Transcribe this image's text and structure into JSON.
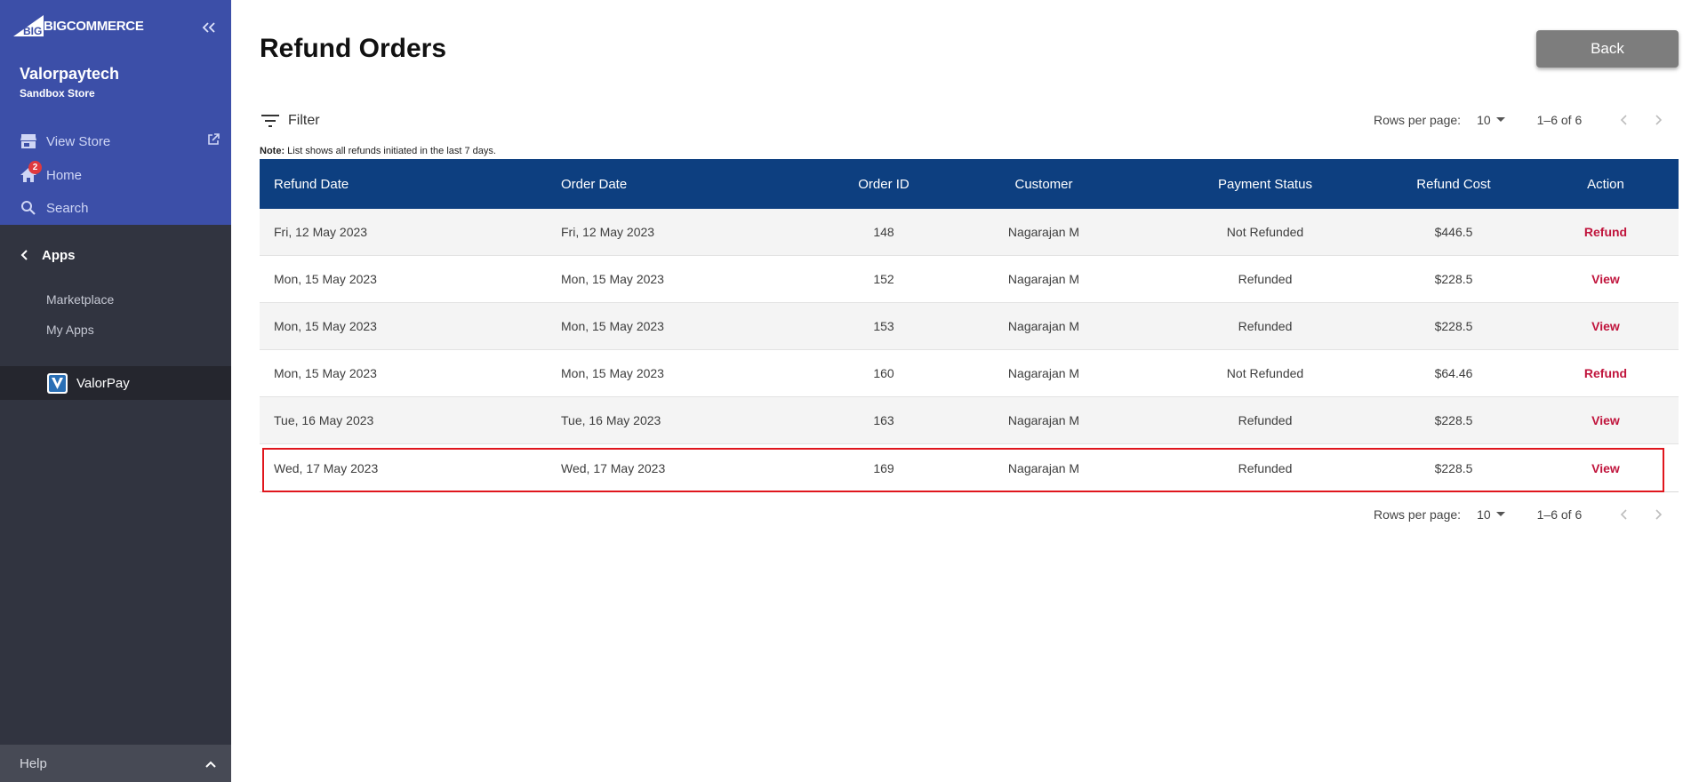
{
  "sidebar": {
    "logo_text": "BIGCOMMERCE",
    "store_name": "Valorpaytech",
    "store_sub": "Sandbox Store",
    "view_store": "View Store",
    "home": "Home",
    "home_badge": "2",
    "search": "Search",
    "apps": "Apps",
    "marketplace": "Marketplace",
    "my_apps": "My Apps",
    "valorpay": "ValorPay",
    "help": "Help"
  },
  "main": {
    "title": "Refund Orders",
    "back_label": "Back",
    "filter_label": "Filter",
    "note_bold": "Note:",
    "note_text": " List shows all refunds initiated in the last 7 days.",
    "pagination": {
      "rows_per_page_label": "Rows per page:",
      "rows_per_page_value": "10",
      "range": "1–6 of 6"
    },
    "columns": [
      "Refund Date",
      "Order Date",
      "Order ID",
      "Customer",
      "Payment Status",
      "Refund Cost",
      "Action"
    ],
    "rows": [
      {
        "refund_date": "Fri, 12 May 2023",
        "order_date": "Fri, 12 May 2023",
        "order_id": "148",
        "customer": "Nagarajan M",
        "status": "Not Refunded",
        "cost": "$446.5",
        "action": "Refund"
      },
      {
        "refund_date": "Mon, 15 May 2023",
        "order_date": "Mon, 15 May 2023",
        "order_id": "152",
        "customer": "Nagarajan M",
        "status": "Refunded",
        "cost": "$228.5",
        "action": "View"
      },
      {
        "refund_date": "Mon, 15 May 2023",
        "order_date": "Mon, 15 May 2023",
        "order_id": "153",
        "customer": "Nagarajan M",
        "status": "Refunded",
        "cost": "$228.5",
        "action": "View"
      },
      {
        "refund_date": "Mon, 15 May 2023",
        "order_date": "Mon, 15 May 2023",
        "order_id": "160",
        "customer": "Nagarajan M",
        "status": "Not Refunded",
        "cost": "$64.46",
        "action": "Refund"
      },
      {
        "refund_date": "Tue, 16 May 2023",
        "order_date": "Tue, 16 May 2023",
        "order_id": "163",
        "customer": "Nagarajan M",
        "status": "Refunded",
        "cost": "$228.5",
        "action": "View"
      },
      {
        "refund_date": "Wed, 17 May 2023",
        "order_date": "Wed, 17 May 2023",
        "order_id": "169",
        "customer": "Nagarajan M",
        "status": "Refunded",
        "cost": "$228.5",
        "action": "View"
      }
    ]
  },
  "colors": {
    "sidebar_top": "#3c4fa8",
    "sidebar": "#313440",
    "table_header": "#0d3f80",
    "action": "#c0143c",
    "highlight": "#e0161d"
  },
  "icons": [
    "collapse-icon",
    "store-icon",
    "external-link-icon",
    "home-icon",
    "search-icon",
    "chevron-left-icon",
    "valorpay-logo-icon",
    "chevron-up-icon",
    "filter-icon",
    "dropdown-arrow-icon",
    "prev-page-icon",
    "next-page-icon"
  ]
}
